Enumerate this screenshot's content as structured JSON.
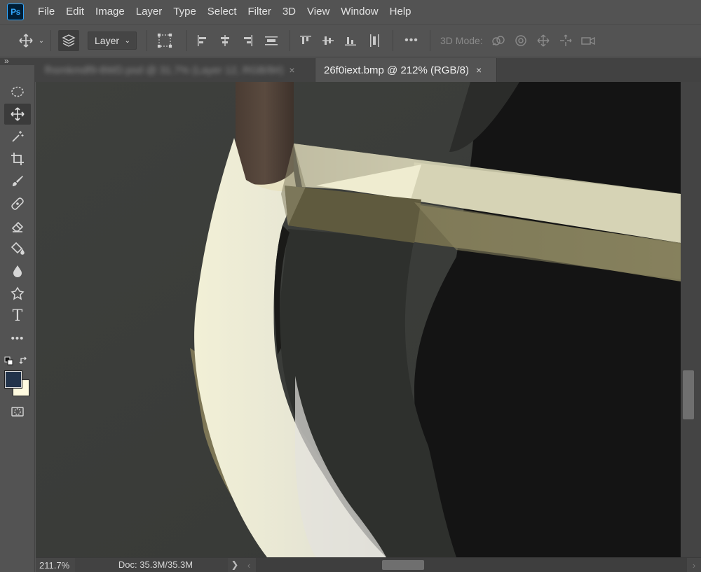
{
  "app": {
    "logo": "Ps",
    "accent": "#31a8ff"
  },
  "menu": [
    "File",
    "Edit",
    "Image",
    "Layer",
    "Type",
    "Select",
    "Filter",
    "3D",
    "View",
    "Window",
    "Help"
  ],
  "options": {
    "tool_icon": "move-icon",
    "auto_select_value": "Layer",
    "more": "•••",
    "mode3d_label": "3D Mode:"
  },
  "tabs": [
    {
      "label": "fhsmkmdf9-8WD.psd @ 31.7% (Layer 12, RGB/8#)",
      "close": "×",
      "active": false
    },
    {
      "label": "26f0iext.bmp @ 212% (RGB/8)",
      "close": "×",
      "active": true
    }
  ],
  "panel_collapse": "»",
  "tools": [
    "elliptical-marquee-icon",
    "move-icon",
    "magic-wand-icon",
    "crop-icon",
    "brush-icon",
    "healing-icon",
    "eraser-icon",
    "paint-bucket-icon",
    "blur-icon",
    "puppet-warp-icon",
    "type-icon",
    "more-tools-icon",
    "quick-mask-icon"
  ],
  "type_tool_glyph": "T",
  "more_tools_glyph": "•••",
  "colors": {
    "foreground": "#22334a",
    "background": "#fffbe0"
  },
  "status": {
    "zoom": "211.7%",
    "doc": "Doc: 35.3M/35.3M",
    "arrow": "❯"
  }
}
